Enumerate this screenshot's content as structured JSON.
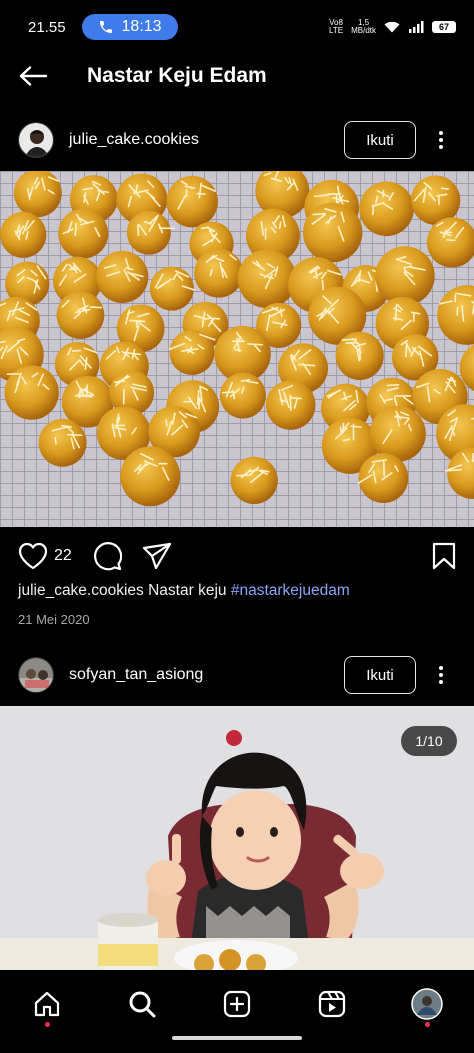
{
  "status_bar": {
    "time": "21.55",
    "call_time": "18:13",
    "network_type_1": "Vo8",
    "network_type_2": "LTE",
    "speed_value": "1,5",
    "speed_unit": "MB/dtk",
    "battery": "67"
  },
  "header": {
    "title": "Nastar Keju Edam",
    "back_icon": "arrow-left-icon"
  },
  "posts": [
    {
      "username": "julie_cake.cookies",
      "follow_label": "Ikuti",
      "likes": "22",
      "caption_user": "julie_cake.cookies",
      "caption_text": "Nastar keju",
      "caption_hashtag": "#nastarkejuedam",
      "date": "21 Mei 2020"
    },
    {
      "username": "sofyan_tan_asiong",
      "follow_label": "Ikuti",
      "image_counter": "1/10"
    }
  ],
  "bottom_nav": {
    "items": [
      "home-icon",
      "search-icon",
      "create-icon",
      "reels-icon",
      "profile-icon"
    ],
    "notification_color": "#ff2b55"
  },
  "colors": {
    "background": "#000000",
    "call_pill": "#3f7ce9",
    "hashtag": "#8ba6f5"
  }
}
